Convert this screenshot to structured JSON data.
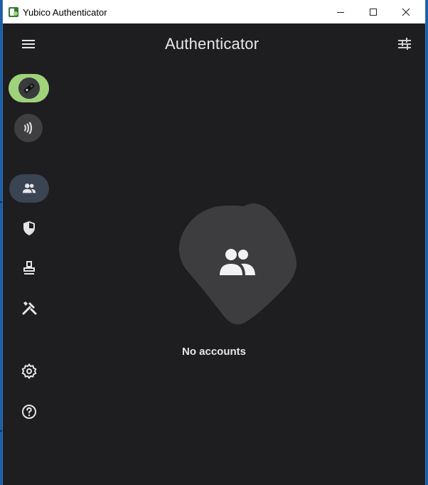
{
  "window": {
    "title": "Yubico Authenticator",
    "controls": [
      "minimize",
      "maximize",
      "close"
    ]
  },
  "header": {
    "title": "Authenticator",
    "menu_icon": "hamburger-menu-icon",
    "settings_icon": "tune-sliders-icon"
  },
  "rail": {
    "devices": [
      {
        "name": "usb-key",
        "icon": "usb-key-icon",
        "selected": true
      },
      {
        "name": "nfc-reader",
        "icon": "nfc-icon",
        "selected": false
      }
    ],
    "sections": [
      {
        "name": "accounts",
        "icon": "people-icon",
        "selected": true
      },
      {
        "name": "security",
        "icon": "shield-icon",
        "selected": false
      },
      {
        "name": "stamp",
        "icon": "stamp-icon",
        "selected": false
      },
      {
        "name": "tools",
        "icon": "tools-icon",
        "selected": false
      }
    ],
    "footer": [
      {
        "name": "settings",
        "icon": "gear-icon"
      },
      {
        "name": "help",
        "icon": "help-icon"
      }
    ]
  },
  "main": {
    "empty_state_text": "No accounts",
    "empty_state_icon": "people-icon"
  },
  "colors": {
    "background": "#1e1e20",
    "accent_device": "#9fd27a",
    "selected_nav": "#3a4452",
    "blob": "#3d3d3f",
    "text": "#e6e6e8"
  }
}
